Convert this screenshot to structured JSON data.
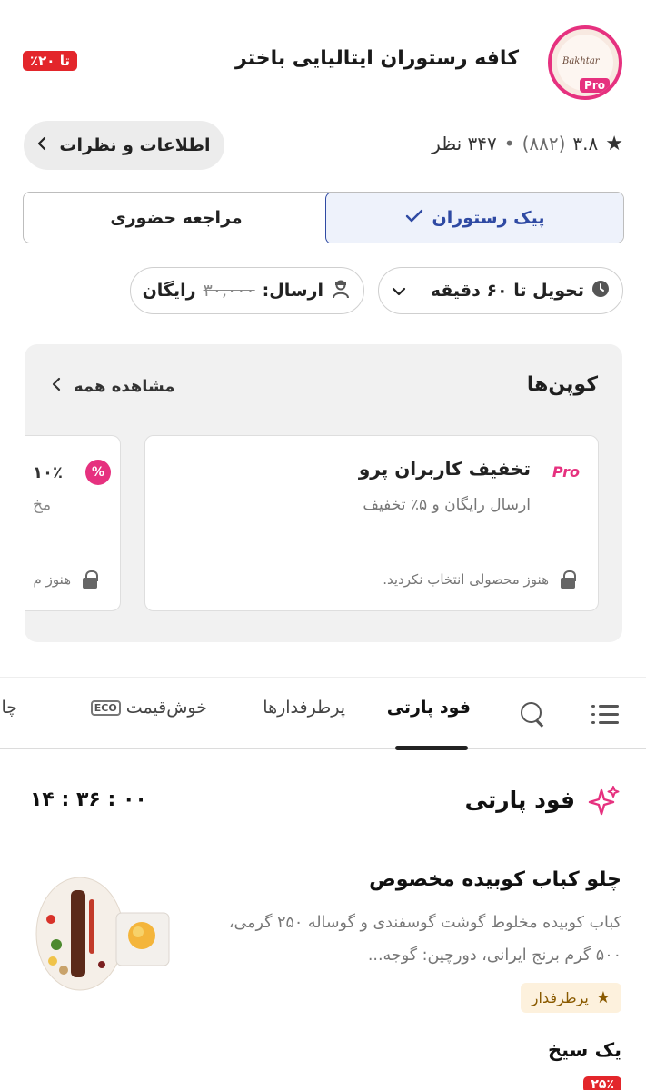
{
  "header": {
    "title": "کافه رستوران ایتالیایی باختر",
    "discount_tag": "تا ۲۰٪",
    "logo_text": "Bakhtar",
    "logo_badge": "Pro"
  },
  "rating": {
    "score": "۳.۸",
    "count": "(۸۸۲)",
    "separator": "•",
    "comments": "۳۴۷ نظر"
  },
  "info_button": {
    "label": "اطلاعات و نظرات"
  },
  "delivery_toggle": {
    "options": [
      {
        "label": "پیک رستوران",
        "selected": true
      },
      {
        "label": "مراجعه حضوری",
        "selected": false
      }
    ]
  },
  "delivery_chips": {
    "time": "تحویل تا ۶۰ دقیقه",
    "send_label": "ارسال:",
    "send_old_price": "۳۰,۰۰۰",
    "send_price": "رایگان"
  },
  "coupons": {
    "title": "کوپن‌ها",
    "see_all": "مشاهده همه",
    "cards": [
      {
        "badge": "Pro",
        "title": "تخفیف کاربران پرو",
        "subtitle": "ارسال رایگان و ۵٪ تخفیف",
        "status": "هنوز محصولی انتخاب نکردید."
      },
      {
        "badge": "%",
        "title": "۱۰٪",
        "subtitle": "مخ",
        "status": "هنوز م"
      }
    ]
  },
  "tabs": {
    "items": [
      {
        "label": "فود پارتی",
        "active": true
      },
      {
        "label": "پرطرفدارها",
        "active": false
      },
      {
        "label": "خوش‌قیمت",
        "badge": "ECO",
        "active": false
      },
      {
        "label": "چا",
        "active": false
      }
    ]
  },
  "food_party": {
    "title": "فود پارتی",
    "timer": "۱۴ : ۳۶ : ۰۰"
  },
  "product": {
    "name": "چلو کباب کوبیده مخصوص",
    "description": "کباب کوبیده مخلوط گوشت گوسفندی و گوساله ۲۵۰ گرمی، ۵۰۰ گرم برنج ایرانی، دورچین: گوجه...",
    "badge": "پرطرفدار",
    "variant": "یک سیخ",
    "discount": "۲۵٪"
  }
}
